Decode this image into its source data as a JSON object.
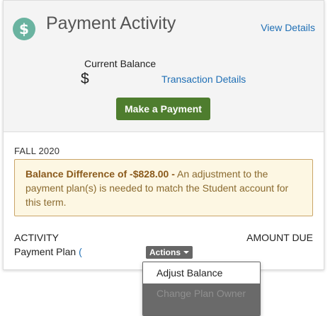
{
  "widget": {
    "title": "Payment Activity",
    "icon": "dollar-icon",
    "icon_glyph": "$",
    "view_details_label": "View Details"
  },
  "balance": {
    "label": "Current Balance",
    "currency_symbol": "$",
    "transaction_details_label": "Transaction Details"
  },
  "make_payment_label": "Make a Payment",
  "term": {
    "label": "FALL 2020",
    "alert": {
      "heading": "Balance Difference of -$828.00 -",
      "message": "An adjustment to the payment plan(s) is needed to match the Student account for this term."
    }
  },
  "activity_table": {
    "col_activity": "ACTIVITY",
    "col_amount_due": "AMOUNT DUE",
    "rows": [
      {
        "label": "Payment Plan",
        "paren": "("
      }
    ]
  },
  "actions_menu": {
    "button_label": "Actions",
    "items": [
      {
        "label": "Adjust Balance",
        "enabled": true
      },
      {
        "label": "Change Plan Owner",
        "enabled": false
      }
    ]
  },
  "colors": {
    "accent_link": "#1f6fb5",
    "primary_button": "#4e7d2e",
    "icon_circle": "#6ab3a0",
    "alert_background": "#fdf7e3",
    "alert_border": "#c9a468"
  }
}
